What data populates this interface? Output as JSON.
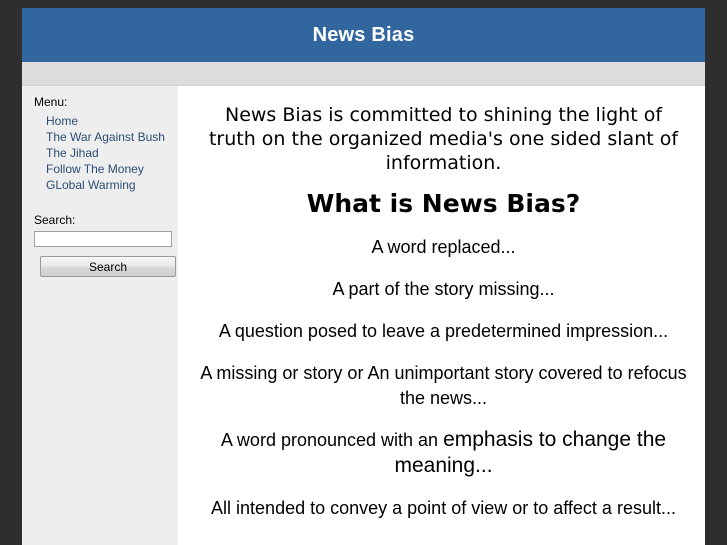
{
  "header": {
    "title": "News Bias"
  },
  "sidebar": {
    "menu_label": "Menu:",
    "items": [
      {
        "label": "Home"
      },
      {
        "label": "The War Against Bush"
      },
      {
        "label": "The Jihad"
      },
      {
        "label": "Follow The Money"
      },
      {
        "label": "GLobal Warming"
      }
    ],
    "search_label": "Search:",
    "search_value": "",
    "search_placeholder": "",
    "search_button_label": "Search"
  },
  "main": {
    "intro": "News Bias is committed to shining the light of truth on the organized media's one sided slant of information.",
    "heading": "What is News Bias?",
    "paragraphs": [
      "A word replaced...",
      "A part of the story missing...",
      "A question posed to leave a predetermined impression...",
      "A missing or story or An unimportant story covered to refocus the news..."
    ],
    "emphasis_paragraph": {
      "lead": "A word pronounced with an ",
      "emphasis": "emphasis to change the meaning..."
    },
    "closing_paragraph": "All intended to convey a point of view or to affect a result..."
  },
  "colors": {
    "header_blue": "#31679e",
    "nav_gray": "#dddddd",
    "sidebar_gray": "#eeeeee",
    "link_blue": "#2a4d73",
    "page_backdrop": "#2e2e2e"
  }
}
